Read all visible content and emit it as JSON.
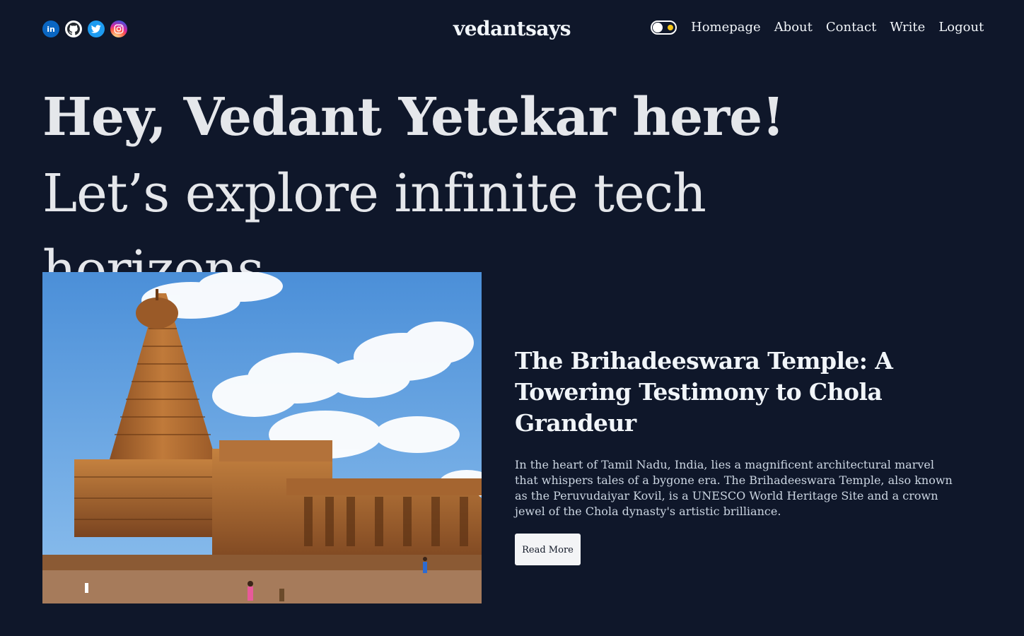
{
  "navbar": {
    "socials": [
      {
        "name": "linkedin-icon",
        "color": "#0a66c2",
        "glyph": "in"
      },
      {
        "name": "github-icon",
        "color": "#ffffff"
      },
      {
        "name": "twitter-icon",
        "color": "#1d9bf0"
      },
      {
        "name": "instagram-icon",
        "color": "#d6249f"
      }
    ],
    "logo": "vedantsays",
    "theme_toggle": {
      "state": "dark",
      "accent": "#f5c518"
    },
    "links": [
      "Homepage",
      "About",
      "Contact",
      "Write",
      "Logout"
    ]
  },
  "hero": {
    "bold_text": "Hey, Vedant Yetekar here!",
    "regular_text": "Let’s explore infinite tech horizons."
  },
  "featured_post": {
    "image_alt": "Brihadeeswara Temple",
    "title": "The Brihadeeswara Temple: A Towering Testimony to Chola Grandeur",
    "description": "In the heart of Tamil Nadu, India, lies a magnificent architectural marvel that whispers tales of a bygone era. The Brihadeeswara Temple, also known as the Peruvudaiyar Kovil, is a UNESCO World Heritage Site and a crown jewel of the Chola dynasty's artistic brilliance.",
    "read_more_label": "Read More"
  },
  "colors": {
    "background": "#0f172a",
    "text": "#e5e7eb",
    "button_bg": "#f3f4f6"
  }
}
